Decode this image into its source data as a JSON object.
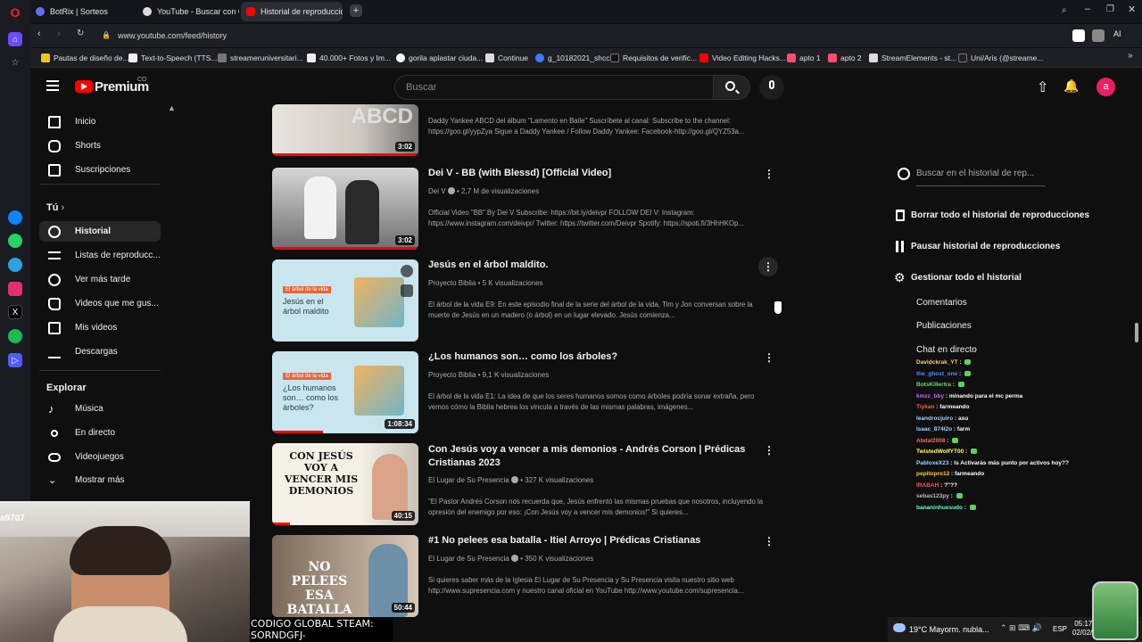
{
  "browser": {
    "tabs": [
      {
        "label": "BotRix | Sorteos"
      },
      {
        "label": "YouTube - Buscar con Goo"
      },
      {
        "label": "Historial de reproducciones"
      }
    ],
    "url": "www.youtube.com/feed/history",
    "ai_label": "AI",
    "bookmarks": [
      {
        "label": "Pautas de diseño de..."
      },
      {
        "label": "Text-to-Speech (TTS..."
      },
      {
        "label": "streameruniversitari..."
      },
      {
        "label": "40.000+ Fotos y Im..."
      },
      {
        "label": "gorila aplastar ciuda..."
      },
      {
        "label": "Continue"
      },
      {
        "label": "g_10182021_shcc"
      },
      {
        "label": "Requisitos de verific..."
      },
      {
        "label": "Video Editing Hacks..."
      },
      {
        "label": "apto 1"
      },
      {
        "label": "apto 2"
      },
      {
        "label": "StreamElements - st..."
      },
      {
        "label": "Uni/Aris (@streame..."
      }
    ]
  },
  "youtube": {
    "logo": "Premium",
    "logo_sup": "CO",
    "search_placeholder": "Buscar",
    "avatar_letter": "a"
  },
  "sidebar": {
    "items": [
      {
        "label": "Inicio",
        "icon": "home-icon"
      },
      {
        "label": "Shorts",
        "icon": "shorts-icon"
      },
      {
        "label": "Suscripciones",
        "icon": "subscriptions-icon"
      }
    ],
    "you_label": "Tú",
    "you_items": [
      {
        "label": "Historial",
        "icon": "history-icon"
      },
      {
        "label": "Listas de reproducc...",
        "icon": "playlists-icon"
      },
      {
        "label": "Ver más tarde",
        "icon": "watch-later-icon"
      },
      {
        "label": "Videos que me gus...",
        "icon": "like-icon"
      },
      {
        "label": "Mis videos",
        "icon": "my-videos-icon"
      },
      {
        "label": "Descargas",
        "icon": "download-icon"
      }
    ],
    "explore_label": "Explorar",
    "explore_items": [
      {
        "label": "Música",
        "icon": "music-icon"
      },
      {
        "label": "En directo",
        "icon": "live-icon"
      },
      {
        "label": "Videojuegos",
        "icon": "gaming-icon"
      },
      {
        "label": "Mostrar más",
        "icon": "chevron-down-icon"
      }
    ]
  },
  "videos": [
    {
      "title": "",
      "meta": "",
      "desc": "Daddy Yankee ABCD del álbum \"Lamento en Baile\" Suscríbete al canal: Subscribe to the channel: https://goo.gl/yypZya Sigue a Daddy Yankee / Follow Daddy Yankee: Facebook-http://goo.gl/QYZ53a...",
      "duration": "3:02",
      "thumb_text": "ABCD",
      "progress": 1.0
    },
    {
      "title": "Dei V - BB (with Blessd) [Official Video]",
      "channel": "Dei V",
      "views": "2,7 M de visualizaciones",
      "desc": "Official Video \"BB\" By Dei V Subscribe: https://bit.ly/deivpr FOLLOW DEI V: Instagram: https://www.instagram.com/deivpr/ Twitter: https://twitter.com/Deivpr Spotify: https://spoti.fi/3HhHKOp...",
      "duration": "3:02",
      "thumb_text": "",
      "progress": 1.0
    },
    {
      "title": "Jesús en el árbol maldito.",
      "channel": "Proyecto Biblia",
      "views": "5 K visualizaciones",
      "desc": "El árbol de la vida E9: En este episodio final de la serie del árbol de la vida, Tim y Jon conversan sobre la muerte de Jesús en un madero (o árbol) en un lugar elevado. Jesús comienza...",
      "duration": "",
      "thumb_tag": "El árbol de la vida",
      "thumb_text": "Jesús en el árbol maldito",
      "progress": 0
    },
    {
      "title": "¿Los humanos son… como los árboles?",
      "channel": "Proyecto Biblia",
      "views": "9,1 K visualizaciones",
      "desc": "El árbol de la vida E1: La idea de que los seres humanos somos como árboles podría sonar extraña, pero vemos cómo la Biblia hebrea los vincula a través de las mismas palabras, imágenes...",
      "duration": "1:08:34",
      "thumb_tag": "El árbol de la vida",
      "thumb_text": "¿Los humanos son… como los árboles?",
      "progress": 0.35
    },
    {
      "title": "Con Jesús voy a vencer a mis demonios - Andrés Corson | Prédicas Cristianas 2023",
      "channel": "El Lugar de Su Presencia",
      "views": "327 K visualizaciones",
      "desc": "\"El Pastor Andrés Corson nos recuerda que, Jesús enfrentó las mismas pruebas que nosotros, incluyendo la opresión del enemigo por eso: ¡Con Jesús voy a vencer mis demonios!\" Si quieres...",
      "duration": "40:15",
      "thumb_text": "CON JESÚS VOY A VENCER MIS DEMONIOS",
      "progress": 0.12
    },
    {
      "title": "#1 No pelees esa batalla - Itiel Arroyo | Prédicas Cristianas",
      "channel": "El Lugar de Su Presencia",
      "views": "350 K visualizaciones",
      "desc": "Si quieres saber más de la Iglesia El Lugar de Su Presencia y Su Presencia visita nuestro sitio web http://www.supresencia.com y nuestro canal oficial en YouTube http://www.youtube.com/supresencia...",
      "duration": "50:44",
      "thumb_text": "NO PELEES ESA BATALLA",
      "progress": 0
    }
  ],
  "right_panel": {
    "search_placeholder": "Buscar en el historial de rep...",
    "clear_all": "Borrar todo el historial de reproducciones",
    "pause": "Pausar historial de reproducciones",
    "manage": "Gestionar todo el historial",
    "sub_items": [
      "Comentarios",
      "Publicaciones",
      "Chat en directo"
    ]
  },
  "chat": [
    {
      "user": "Davidckrak_YT",
      "msg": "",
      "color": "#ffcc66"
    },
    {
      "user": "the_ghost_one",
      "msg": "",
      "color": "#4f8bff"
    },
    {
      "user": "BotsKillertra",
      "msg": "",
      "color": "#66dd66"
    },
    {
      "user": "kmzz_bby",
      "msg": "minando para el mc perma",
      "color": "#cc66ff"
    },
    {
      "user": "Tiykan",
      "msg": "farmeando",
      "color": "#ff5555"
    },
    {
      "user": "leandrocjuiro",
      "msg": "asu",
      "color": "#9fd0ff"
    },
    {
      "user": "Isaac_874l2o",
      "msg": "farm",
      "color": "#9fd0ff"
    },
    {
      "user": "Abdal2008",
      "msg": "",
      "color": "#ff6666"
    },
    {
      "user": "TwistedWolfYT00",
      "msg": "",
      "color": "#ffff66"
    },
    {
      "user": "PabloxeX23",
      "msg": "Is Activarás más punto por activos hoy??",
      "color": "#9fd0ff"
    },
    {
      "user": "pepitopro12",
      "msg": "farmeando",
      "color": "#ffcc33"
    },
    {
      "user": "IRABAH",
      "msg": "?\"??",
      "color": "#ff5555"
    },
    {
      "user": "sebas123py",
      "msg": "",
      "color": "#bbbbbb"
    },
    {
      "user": "bananinhuesudo",
      "msg": "",
      "color": "#66ffcc"
    }
  ],
  "overlay": {
    "stream_code_line1": "CODIGO GLOBAL STEAM:",
    "stream_code_line2": "SORNDGFJ-",
    "webcam_tag": "a9707"
  },
  "taskbar": {
    "weather": "19°C  Mayorm. nubla...",
    "lang": "ESP",
    "time": "05:17",
    "date": "02/02/"
  }
}
